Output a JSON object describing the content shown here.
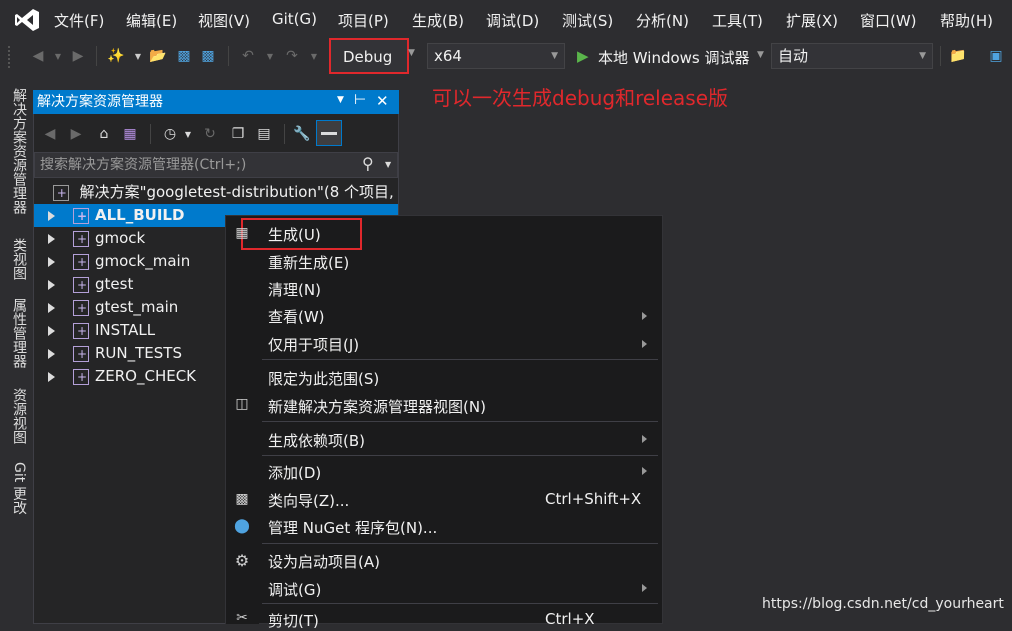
{
  "menubar": {
    "items": [
      "文件(F)",
      "编辑(E)",
      "视图(V)",
      "Git(G)",
      "项目(P)",
      "生成(B)",
      "调试(D)",
      "测试(S)",
      "分析(N)",
      "工具(T)",
      "扩展(X)",
      "窗口(W)",
      "帮助(H)"
    ]
  },
  "toolbar": {
    "configuration": "Debug",
    "platform": "x64",
    "run_target": "本地 Windows 调试器",
    "run_mode": "自动"
  },
  "annotation": "可以一次生成debug和release版",
  "left_tabs": [
    "解决方案资源管理器",
    "类视图",
    "属性管理器",
    "资源视图",
    "Git 更改"
  ],
  "solution_explorer": {
    "title": "解决方案资源管理器",
    "search_placeholder": "搜索解决方案资源管理器(Ctrl+;)",
    "solution_label": "解决方案\"googletest-distribution\"(8 个项目,",
    "projects": [
      "ALL_BUILD",
      "gmock",
      "gmock_main",
      "gtest",
      "gtest_main",
      "INSTALL",
      "RUN_TESTS",
      "ZERO_CHECK"
    ]
  },
  "context_menu": {
    "items": [
      {
        "label": "生成(U)"
      },
      {
        "label": "重新生成(E)"
      },
      {
        "label": "清理(N)"
      },
      {
        "label": "查看(W)"
      },
      {
        "label": "仅用于项目(J)"
      },
      {
        "label": "限定为此范围(S)"
      },
      {
        "label": "新建解决方案资源管理器视图(N)"
      },
      {
        "label": "生成依赖项(B)"
      },
      {
        "label": "添加(D)"
      },
      {
        "label": "类向导(Z)...",
        "shortcut": "Ctrl+Shift+X"
      },
      {
        "label": "管理 NuGet 程序包(N)..."
      },
      {
        "label": "设为启动项目(A)"
      },
      {
        "label": "调试(G)"
      },
      {
        "label": "剪切(T)",
        "shortcut": "Ctrl+X"
      }
    ]
  },
  "watermark": "https://blog.csdn.net/cd_yourheart",
  "colors": {
    "accent": "#007acc",
    "highlight_red": "#e0282c",
    "background": "#2d2d30"
  }
}
